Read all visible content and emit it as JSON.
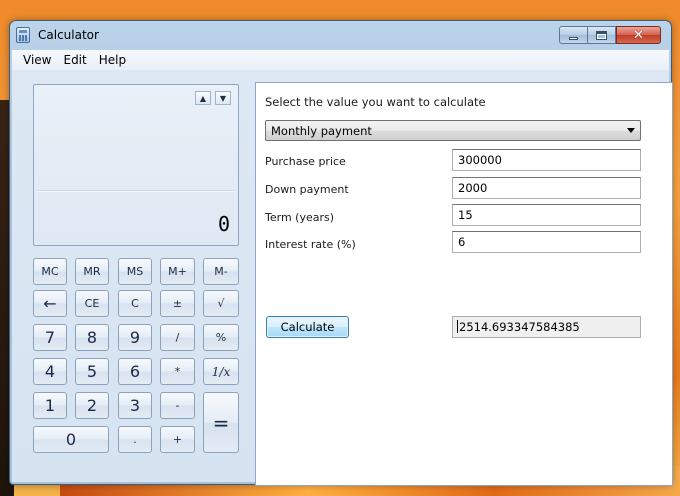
{
  "window": {
    "title": "Calculator",
    "close_symbol": "✕"
  },
  "menu": {
    "items": [
      "View",
      "Edit",
      "Help"
    ]
  },
  "display": {
    "history_up_symbol": "▲",
    "history_down_symbol": "▼",
    "value": "0"
  },
  "keypad": {
    "memory": [
      "MC",
      "MR",
      "MS",
      "M+",
      "M-"
    ],
    "row2": [
      "←",
      "CE",
      "C",
      "±",
      "√"
    ],
    "row3": [
      "7",
      "8",
      "9",
      "/",
      "%"
    ],
    "row4": [
      "4",
      "5",
      "6",
      "*",
      "1/x"
    ],
    "row5": [
      "1",
      "2",
      "3",
      "-"
    ],
    "row6": [
      "0",
      ".",
      "+"
    ],
    "equals": "="
  },
  "mortgage": {
    "prompt": "Select the value you want to calculate",
    "selected": "Monthly payment",
    "fields": [
      {
        "label": "Purchase price",
        "value": "300000"
      },
      {
        "label": "Down payment",
        "value": "2000"
      },
      {
        "label": "Term (years)",
        "value": "15"
      },
      {
        "label": "Interest rate (%)",
        "value": "6"
      }
    ],
    "calculate_label": "Calculate",
    "result": "2514.693347584385"
  }
}
